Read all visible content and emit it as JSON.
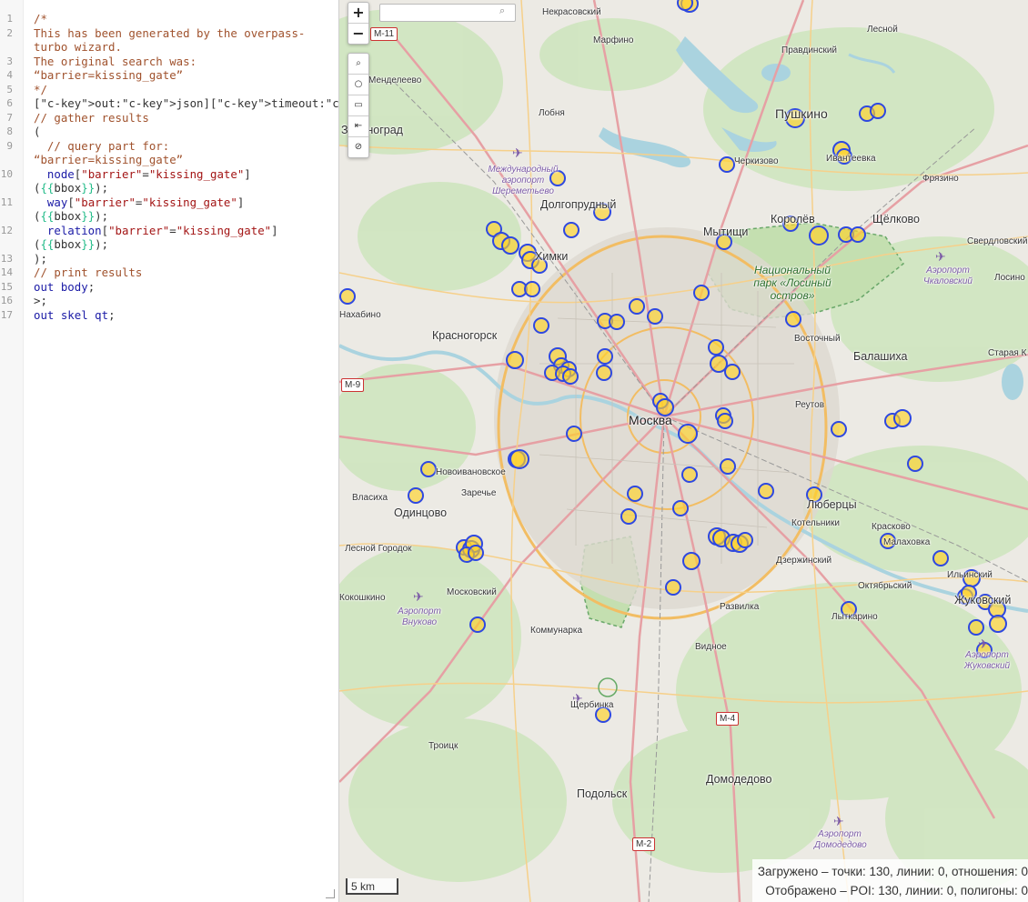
{
  "editor": {
    "lines": [
      "/*",
      "This has been generated by the overpass-",
      "turbo wizard.",
      "The original search was:",
      "“barrier=kissing_gate”",
      "*/",
      "[out:json][timeout:25];",
      "// gather results",
      "(",
      "  // query part for:",
      "“barrier=kissing_gate”",
      "  node[\"barrier\"=\"kissing_gate\"]",
      "({{bbox}});",
      "  way[\"barrier\"=\"kissing_gate\"]",
      "({{bbox}});",
      "  relation[\"barrier\"=\"kissing_gate\"]",
      "({{bbox}});",
      ");",
      "// print results",
      "out body;",
      ">;",
      "out skel qt;"
    ],
    "line_numbers": [
      "1",
      "2",
      "",
      "3",
      "4",
      "5",
      "6",
      "7",
      "8",
      "9",
      "",
      "10",
      "",
      "11",
      "",
      "12",
      "",
      "13",
      "14",
      "15",
      "16",
      "17"
    ]
  },
  "map": {
    "zoom_in": "+",
    "zoom_out": "−",
    "tools": [
      "⌕",
      "○",
      "▭",
      "⇤",
      "⊘"
    ],
    "scale": "5 km",
    "stats_loaded": "Загружено – точки: 130, линии: 0, отношения: 0",
    "stats_shown": "Отображено – POI: 130, линии: 0, полигоны: 0",
    "shields": [
      "M-11",
      "M-9",
      "M-4",
      "M-2"
    ],
    "labels": {
      "nekrasovsky": "Некрасовский",
      "lesnoy": "Лесной",
      "marfino": "Марфино",
      "pravdinsky": "Правдинский",
      "mendeleevo": "Менделеево",
      "lobnya": "Лобня",
      "pushkino": "Пушкино",
      "zelenograd": "Зеленоград",
      "cherkizovo": "Черкизово",
      "ivanteevka": "Ивантеевка",
      "sheremetyevo": "Международный аэропорт Шереметьево",
      "fryazino": "Фрязино",
      "dolgoprudny": "Долгопрудный",
      "korolev": "Королёв",
      "shchelkovo": "Щёлково",
      "mytishchi": "Мытищи",
      "sverdlovsky": "Свердловский",
      "khimki": "Химки",
      "losiny_park": "Национальный парк «Лосиный остров»",
      "chkalovsky": "Аэропорт Чкаловский",
      "losino": "Лосино",
      "nakhabino": "Нахабино",
      "krasnogorsk": "Красногорск",
      "vostochny": "Восточный",
      "balashikha": "Балашиха",
      "staraya": "Старая К",
      "reutov": "Реутов",
      "moskva": "Москва",
      "novoivanovskoe": "Новоивановское",
      "zarechye": "Заречье",
      "vlasikha": "Власиха",
      "odintsovo": "Одинцово",
      "lyubertsy": "Люберцы",
      "kotelniki": "Котельники",
      "kraskovo": "Красково",
      "malakhovka": "Малаховка",
      "lesnoy_gorodok": "Лесной Городок",
      "dzerzhinsky": "Дзержинский",
      "ilyinsky": "Ильинский",
      "oktyabrsky": "Октябрьский",
      "kokoshkino": "Кокошкино",
      "moskovsky": "Московский",
      "vnukovo": "Аэропорт Внуково",
      "razvilka": "Развилка",
      "zhukovsky": "Жуковский",
      "lytkarino": "Лыткарино",
      "kommunarka": "Коммунарка",
      "vidnoe": "Видное",
      "zhukovsky_airport": "Аэропорт Жуковский",
      "shcherbinka": "Щербинка",
      "troitsk": "Троицк",
      "domodedovo": "Домодедово",
      "podolsk": "Подольск",
      "domodedovo_airport": "Аэропорт Домодедово"
    }
  }
}
